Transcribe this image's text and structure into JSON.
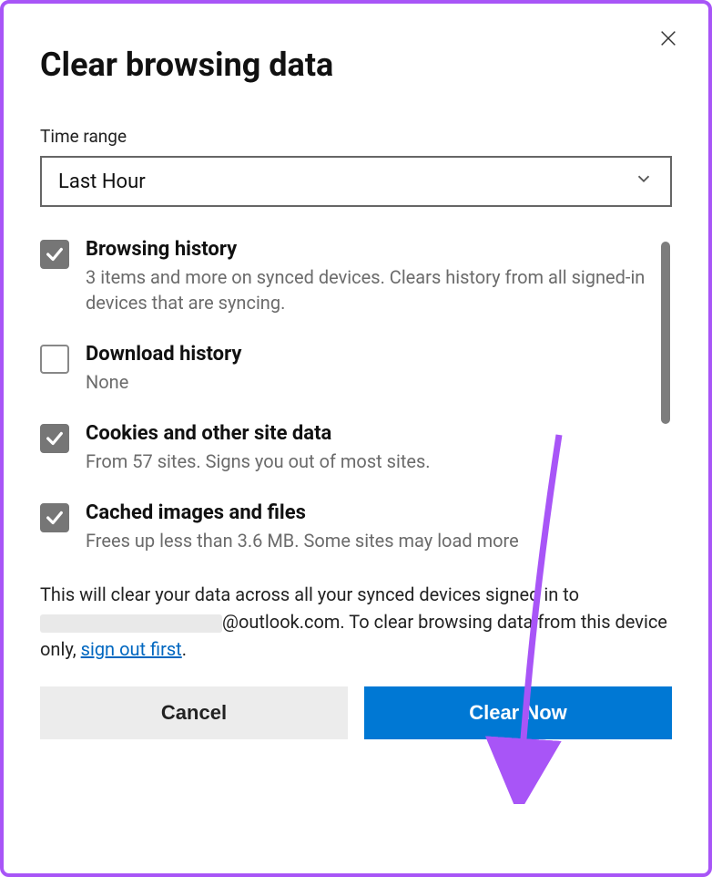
{
  "title": "Clear browsing data",
  "time_range_label": "Time range",
  "time_range_value": "Last Hour",
  "options": [
    {
      "title": "Browsing history",
      "desc": "3 items and more on synced devices. Clears history from all signed-in devices that are syncing.",
      "checked": true
    },
    {
      "title": "Download history",
      "desc": "None",
      "checked": false
    },
    {
      "title": "Cookies and other site data",
      "desc": "From 57 sites. Signs you out of most sites.",
      "checked": true
    },
    {
      "title": "Cached images and files",
      "desc": "Frees up less than 3.6 MB. Some sites may load more",
      "checked": true
    }
  ],
  "footer": {
    "pre": "This will clear your data across all your synced devices signed in to ",
    "email_domain": "@outlook.com. To clear browsing data from this device only, ",
    "link": "sign out first",
    "suffix": "."
  },
  "buttons": {
    "cancel": "Cancel",
    "clear": "Clear Now"
  }
}
